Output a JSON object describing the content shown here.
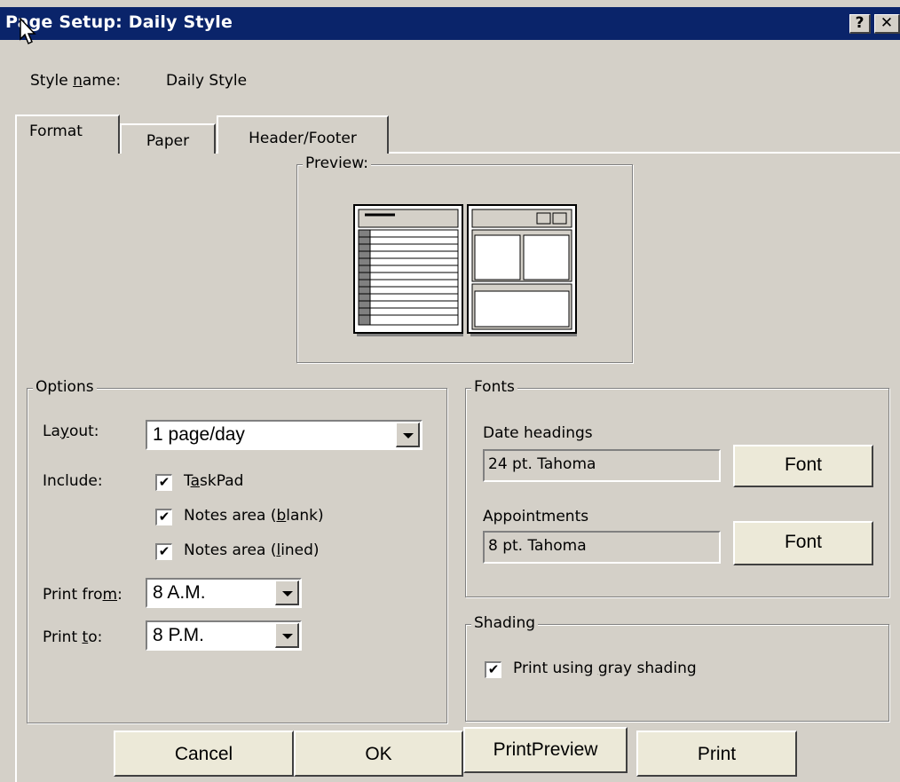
{
  "window": {
    "title": "Page Setup: Daily Style",
    "help_glyph": "?",
    "close_glyph": "✕"
  },
  "style_name": {
    "label_pre": "Style ",
    "label_accel": "n",
    "label_post": "ame:",
    "value": "Daily Style"
  },
  "tabs": [
    {
      "label": "Format",
      "active": true
    },
    {
      "label": "Paper",
      "active": false
    },
    {
      "label": "Header/Footer",
      "active": false
    }
  ],
  "preview": {
    "label": "Preview:"
  },
  "options": {
    "label": "Options",
    "layout_label_pre": "La",
    "layout_label_accel": "y",
    "layout_label_post": "out:",
    "layout_value": "1 page/day",
    "include_label": "Include:",
    "checkboxes": [
      {
        "pre": "T",
        "accel": "a",
        "post": "skPad",
        "checked": true
      },
      {
        "pre": "Notes area (",
        "accel": "b",
        "post": "lank)",
        "checked": true
      },
      {
        "pre": "Notes area (",
        "accel": "l",
        "post": "ined)",
        "checked": true
      }
    ],
    "print_from_pre": "Print fro",
    "print_from_accel": "m",
    "print_from_post": ":",
    "print_from_value": "8 A.M.",
    "print_to_pre": "Print ",
    "print_to_accel": "t",
    "print_to_post": "o:",
    "print_to_value": "8 P.M."
  },
  "fonts": {
    "label": "Fonts",
    "date_headings_label": "Date headings",
    "date_headings_value": "24 pt. Tahoma",
    "appointments_label": "Appointments",
    "appointments_value": "8 pt. Tahoma",
    "font_button": "Font"
  },
  "shading": {
    "label": "Shading",
    "checkbox_pre": "Print using ",
    "checkbox_accel": "g",
    "checkbox_post": "ray shading",
    "checked": true
  },
  "buttons": {
    "cancel": "Cancel",
    "ok": "OK",
    "print_preview": "PrintPreview",
    "print": "Print"
  },
  "check_glyph": "✔"
}
